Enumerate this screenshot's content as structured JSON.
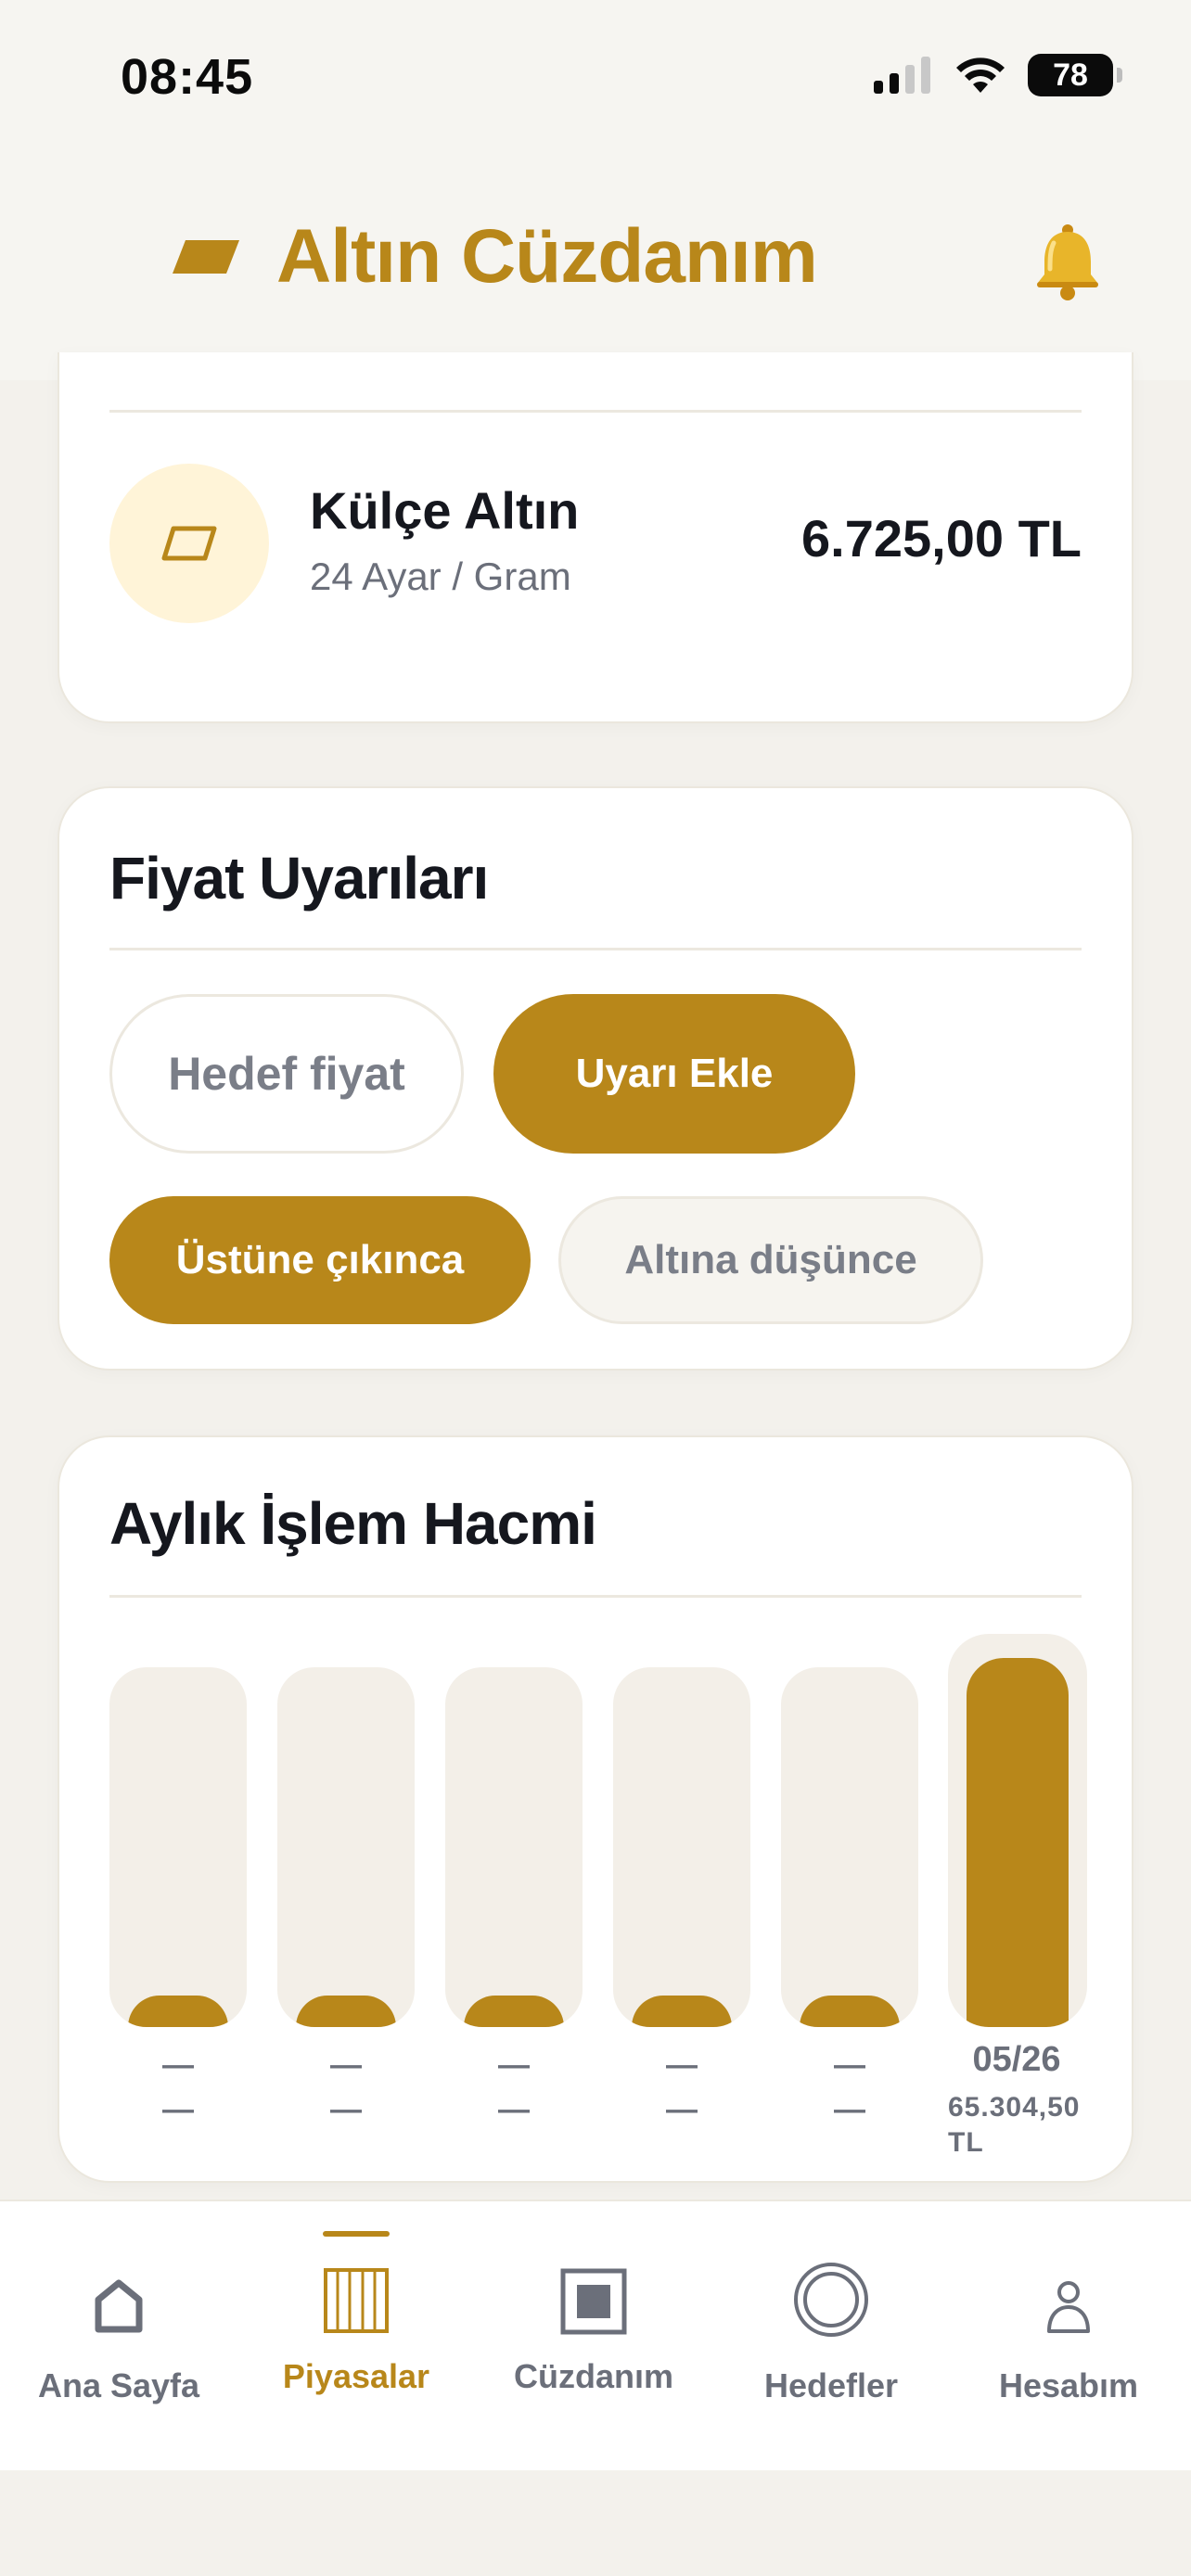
{
  "status": {
    "time": "08:45",
    "battery": "78"
  },
  "header": {
    "title": "Altın Cüzdanım"
  },
  "product": {
    "name": "Külçe Altın",
    "subtitle": "24 Ayar / Gram",
    "price": "6.725,00 TL"
  },
  "alerts": {
    "title": "Fiyat Uyarıları",
    "input_placeholder": "Hedef fiyat",
    "add_button": "Uyarı Ekle",
    "above_label": "Üstüne çıkınca",
    "below_label": "Altına düşünce"
  },
  "volume": {
    "title": "Aylık İşlem Hacmi"
  },
  "chart_data": {
    "type": "bar",
    "title": "Aylık İşlem Hacmi",
    "categories": [
      "—",
      "—",
      "—",
      "—",
      "—",
      "05/26"
    ],
    "value_labels": [
      "—",
      "—",
      "—",
      "—",
      "—",
      "65.304,50 TL"
    ],
    "values": [
      0,
      0,
      0,
      0,
      0,
      65304.5
    ],
    "colors": {
      "fill": "#b8871a",
      "track": "#f3efe8"
    }
  },
  "tabs": [
    {
      "label": "Ana Sayfa",
      "icon": "home-icon"
    },
    {
      "label": "Piyasalar",
      "icon": "markets-icon",
      "active": true
    },
    {
      "label": "Cüzdanım",
      "icon": "wallet-icon"
    },
    {
      "label": "Hedefler",
      "icon": "target-icon"
    },
    {
      "label": "Hesabım",
      "icon": "account-icon"
    }
  ],
  "colors": {
    "accent": "#b8871a",
    "background": "#f3f1ec",
    "text": "#15171e",
    "muted": "#6b6f7a"
  }
}
